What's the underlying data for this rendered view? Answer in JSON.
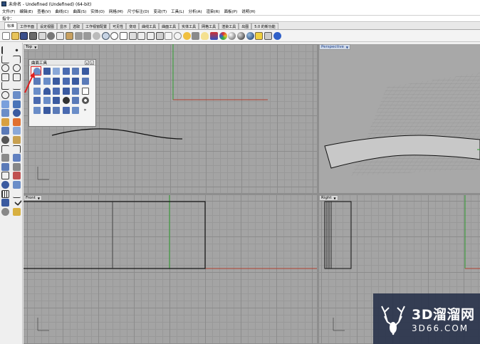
{
  "window": {
    "title": "未命名 - Undefined (Undefined) (64-bit)"
  },
  "menu": [
    "文件(F)",
    "编辑(E)",
    "查看(V)",
    "曲线(C)",
    "曲面(S)",
    "实体(O)",
    "网格(M)",
    "尺寸标注(D)",
    "变动(T)",
    "工具(L)",
    "分析(A)",
    "渲染(R)",
    "面板(P)",
    "说明(H)"
  ],
  "command": {
    "label": "指令：",
    "value": ""
  },
  "tabs": [
    "标准",
    "工作平面",
    "设定视图",
    "显示",
    "选取",
    "工作视窗配置",
    "可见性",
    "变动",
    "曲线工具",
    "曲面工具",
    "实体工具",
    "网格工具",
    "渲染工具",
    "出图",
    "5.0 的新功能"
  ],
  "active_tab": "标准",
  "toolbar_icons": [
    "new-icon",
    "open-icon",
    "save-icon",
    "print-icon",
    "import-icon",
    "cut-icon",
    "copy-icon",
    "paste-icon",
    "undo-icon",
    "redo-icon",
    "pan-icon",
    "rotate-view-icon",
    "zoom-icon",
    "zoom-window-icon",
    "zoom-extents-icon",
    "zoom-selected-icon",
    "grid-icon",
    "viewports-icon",
    "select-icon",
    "circle-select-icon",
    "point-icon",
    "lock-icon",
    "light-bulb-icon",
    "layer-icon",
    "material-icon",
    "render-sphere-icon",
    "render-icon",
    "env-icon",
    "object-properties-icon",
    "options-icon",
    "help-icon"
  ],
  "viewports": {
    "top": {
      "label": "Top"
    },
    "perspective": {
      "label": "Perspective"
    },
    "front": {
      "label": "Front"
    },
    "right": {
      "label": "Right"
    }
  },
  "float_panel": {
    "title": "曲面工具"
  },
  "watermark": {
    "main": "3D溜溜网",
    "sub": "3D66.COM"
  },
  "colors": {
    "x_axis": "#b04030",
    "y_axis": "#30a030",
    "highlight": "#e02020",
    "viewport_bg": "#a4a4a4",
    "surface": "#c8c8c8"
  }
}
